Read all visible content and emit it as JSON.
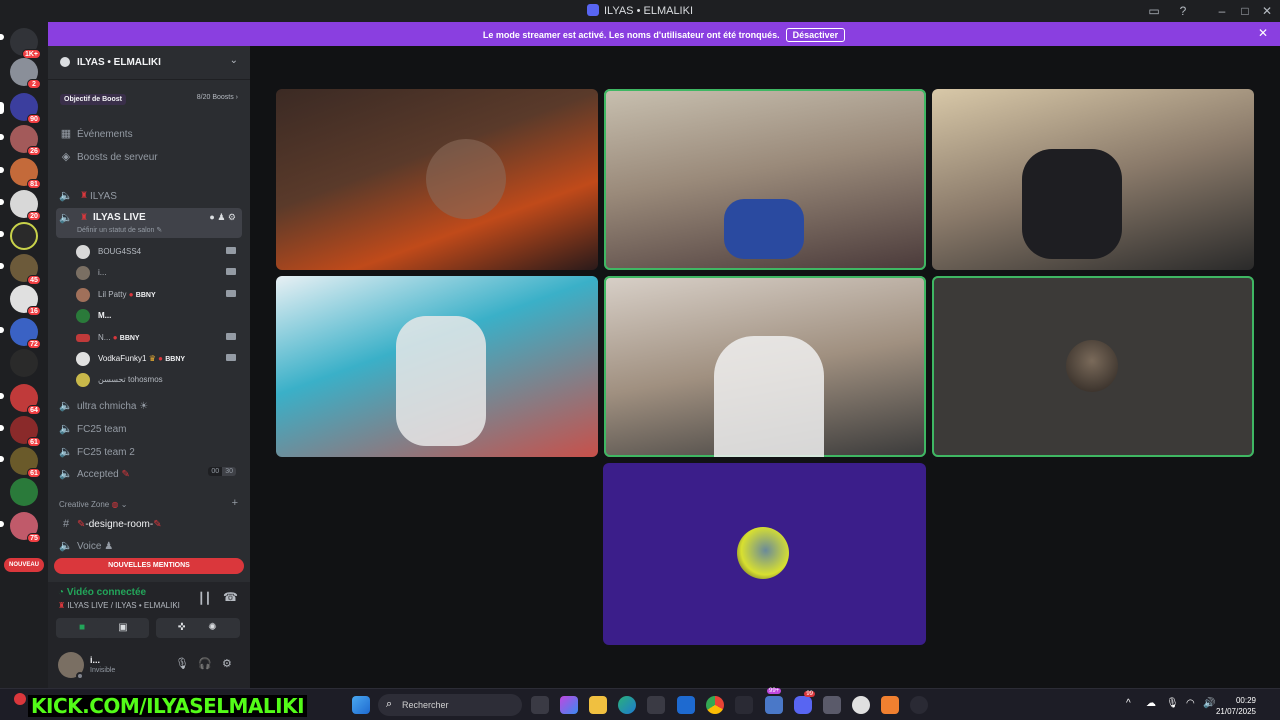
{
  "window": {
    "title": "ILYAS • ELMALIKI"
  },
  "banner": {
    "message": "Le mode streamer est activé. Les noms d'utilisateur ont été tronqués.",
    "button": "Désactiver"
  },
  "rail": {
    "badges": [
      "1K+",
      "2",
      "90",
      "26",
      "81",
      "20",
      "45",
      "16",
      "72",
      "64",
      "61",
      "61",
      "75"
    ],
    "new_label": "NOUVEAU"
  },
  "server": {
    "name": "ILYAS • ELMALIKI",
    "boost_label": "Objectif de Boost",
    "boost_count": "8/20 Boosts",
    "events": "Événements",
    "server_boosts": "Boosts de serveur"
  },
  "channels": {
    "ilyas": "ILYAS",
    "ilyas_live": "ILYAS LIVE",
    "status_hint": "Définir un statut de salon",
    "members": [
      {
        "name": "BOUG4SS4",
        "tag": ""
      },
      {
        "name": "i...",
        "tag": ""
      },
      {
        "name": "Lil Patty",
        "tag": "BBNY"
      },
      {
        "name": "M...",
        "tag": ""
      },
      {
        "name": "N...",
        "tag": "BBNY"
      },
      {
        "name": "VodkaFunky1",
        "tag": "BBNY"
      },
      {
        "name": "تحسسن tohosmos",
        "tag": ""
      }
    ],
    "ultra": "ultra chmicha ☀",
    "fc25": "FC25 team",
    "fc25_2": "FC25 team 2",
    "accepted": "Accepted",
    "accepted_counts": [
      "00",
      "30"
    ],
    "category": "Creative Zone",
    "designe": "-designe-room-",
    "voice": "Voice"
  },
  "mentions_label": "NOUVELLES MENTIONS",
  "voice_panel": {
    "status": "Vidéo connectée",
    "channel": "ILYAS LIVE / ILYAS • ELMALIKI"
  },
  "user": {
    "name": "i...",
    "status": "Invisible"
  },
  "taskbar": {
    "kick": "KICK.COM/ILYASELMALIKI",
    "search_placeholder": "Rechercher",
    "time": "00:29",
    "date": "21/07/2025",
    "badge_99": "99+",
    "badge_discord": "99"
  },
  "colors": {
    "accent": "#5865f2",
    "banner": "#8a3fe0",
    "speaking": "#3fb763",
    "mention": "#da373c",
    "kick": "#53fc18"
  }
}
